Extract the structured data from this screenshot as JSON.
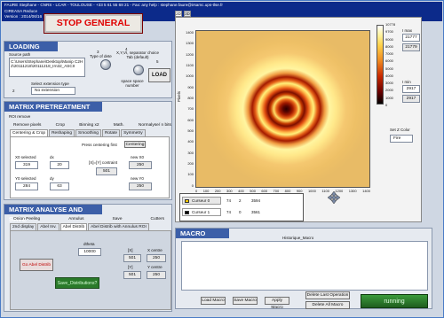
{
  "header": {
    "line1": "FAURE Stephane - CNRS - LCAR - TOULOUSE - +33 5 61 55 68 21 - Fax: any help : stephane.faure@irsamc.ups-tlse.fr",
    "line2": "CIREASA Reduce",
    "line3": "Version : 2014/06/16"
  },
  "stop_label": "STOP GENERAL",
  "loading": {
    "title": "LOADING",
    "source_path_label": "Source path",
    "source_path": "C:\\Users\\Stephane\\Desktop\\Manip C2H2\\20111218\\20111218_Irn32_ASCII",
    "badge1": "1",
    "type_detie_label": "Type of dete",
    "badge3": "3",
    "badge4": "4",
    "separator_label": "X,Y,VI, separator choice Tab (default)",
    "badge2": "2",
    "select_ext_label": "Select extension type",
    "ext_value": "No extension",
    "space_label": "space space number",
    "badge5": "5",
    "load_label": "LOAD"
  },
  "matrix_pre": {
    "title": "MATRIX PRETREATMENT",
    "roi_label": "ROI remove",
    "tabs_row1": [
      "Remove pixels",
      "Crop",
      "Binning x2",
      "Math.",
      "Normalyse/ n bits"
    ],
    "tabs_row2": [
      "Centering & Crop",
      "Reshaping",
      "Smoothing",
      "Rotate",
      "Symmetry"
    ],
    "press_centering": "Press centering first",
    "centering_btn": "Centering",
    "x0_label": "X0 selected",
    "x0_val": "319",
    "dx_label": "dx",
    "dx_val": "20",
    "xy_label": "[X]=[Y] contraint",
    "xy_val": "501",
    "newx0_label": "new X0",
    "newx0_val": "250",
    "y0_label": "Y0 selected",
    "y0_val": "284",
    "dy_label": "dy",
    "dy_val": "63",
    "newy0_label": "new Y0",
    "newy0_val": "250"
  },
  "matrix_an": {
    "title": "MATRIX ANALYSE AND SAVE",
    "tabs_row1": [
      "Onion Peeling",
      "Annulus",
      "Save",
      "Cutters"
    ],
    "tabs_row2": [
      "2nd display",
      "Abel Inv.",
      "Abel Distrib",
      "Abel Distrib with Annulus ROI"
    ],
    "dtheta_label": "dtheta",
    "dtheta_val": "10000",
    "go_abel": "Go Abel Distrib",
    "x_label": "[X]",
    "x_val": "501",
    "y_label": "[Y]",
    "y_val": "501",
    "xcentre_label": "X centre",
    "xcentre_val": "250",
    "ycentre_label": "Y centre",
    "ycentre_val": "250",
    "save_dist": "Save_Distributions?"
  },
  "viewer": {
    "tab2d": "2D",
    "tab3d": "3D",
    "xaxis_label": "Pixels",
    "yaxis_label": "Pixels",
    "yticks": [
      "1400",
      "1300",
      "1200",
      "1100",
      "1000",
      "900",
      "800",
      "700",
      "600",
      "500",
      "400",
      "300",
      "200",
      "100",
      "0"
    ],
    "xticks": [
      "0",
      "100",
      "200",
      "300",
      "400",
      "500",
      "600",
      "700",
      "800",
      "900",
      "1000",
      "1100",
      "1200",
      "1300",
      "1400"
    ],
    "scale_ticks": [
      "10778",
      "9700",
      "9000",
      "8000",
      "7000",
      "6000",
      "5000",
      "4000",
      "3000",
      "2000",
      "1000",
      "0"
    ],
    "imax_label": "I max",
    "imax_val": "21777",
    "imax2_val": "21779",
    "imin_label": "I min",
    "imin_val": "2917",
    "imin2_val": "2917",
    "zcolor_label": "Set Z Color",
    "zcolor_val": "Fire"
  },
  "cursors": {
    "rows": [
      {
        "name": "Curseur 0",
        "x": "",
        "y": "2",
        "v": "3594"
      },
      {
        "name": "Curseur 1",
        "x": "74",
        "y": "0",
        "v": "3561"
      }
    ],
    "sub": "74"
  },
  "macro": {
    "title": "MACRO",
    "historique": "Historique_Macro",
    "load": "Load Macro",
    "save": "Save Macro",
    "apply": "Apply Macro",
    "delete_last": "Delete Last Operation",
    "delete_all": "Delete All Macro",
    "status": "running"
  },
  "colors": {
    "header": "#0c2a8a",
    "section": "#3c5fa8",
    "stop_text": "#e00000",
    "running": "#2a7a2a"
  }
}
